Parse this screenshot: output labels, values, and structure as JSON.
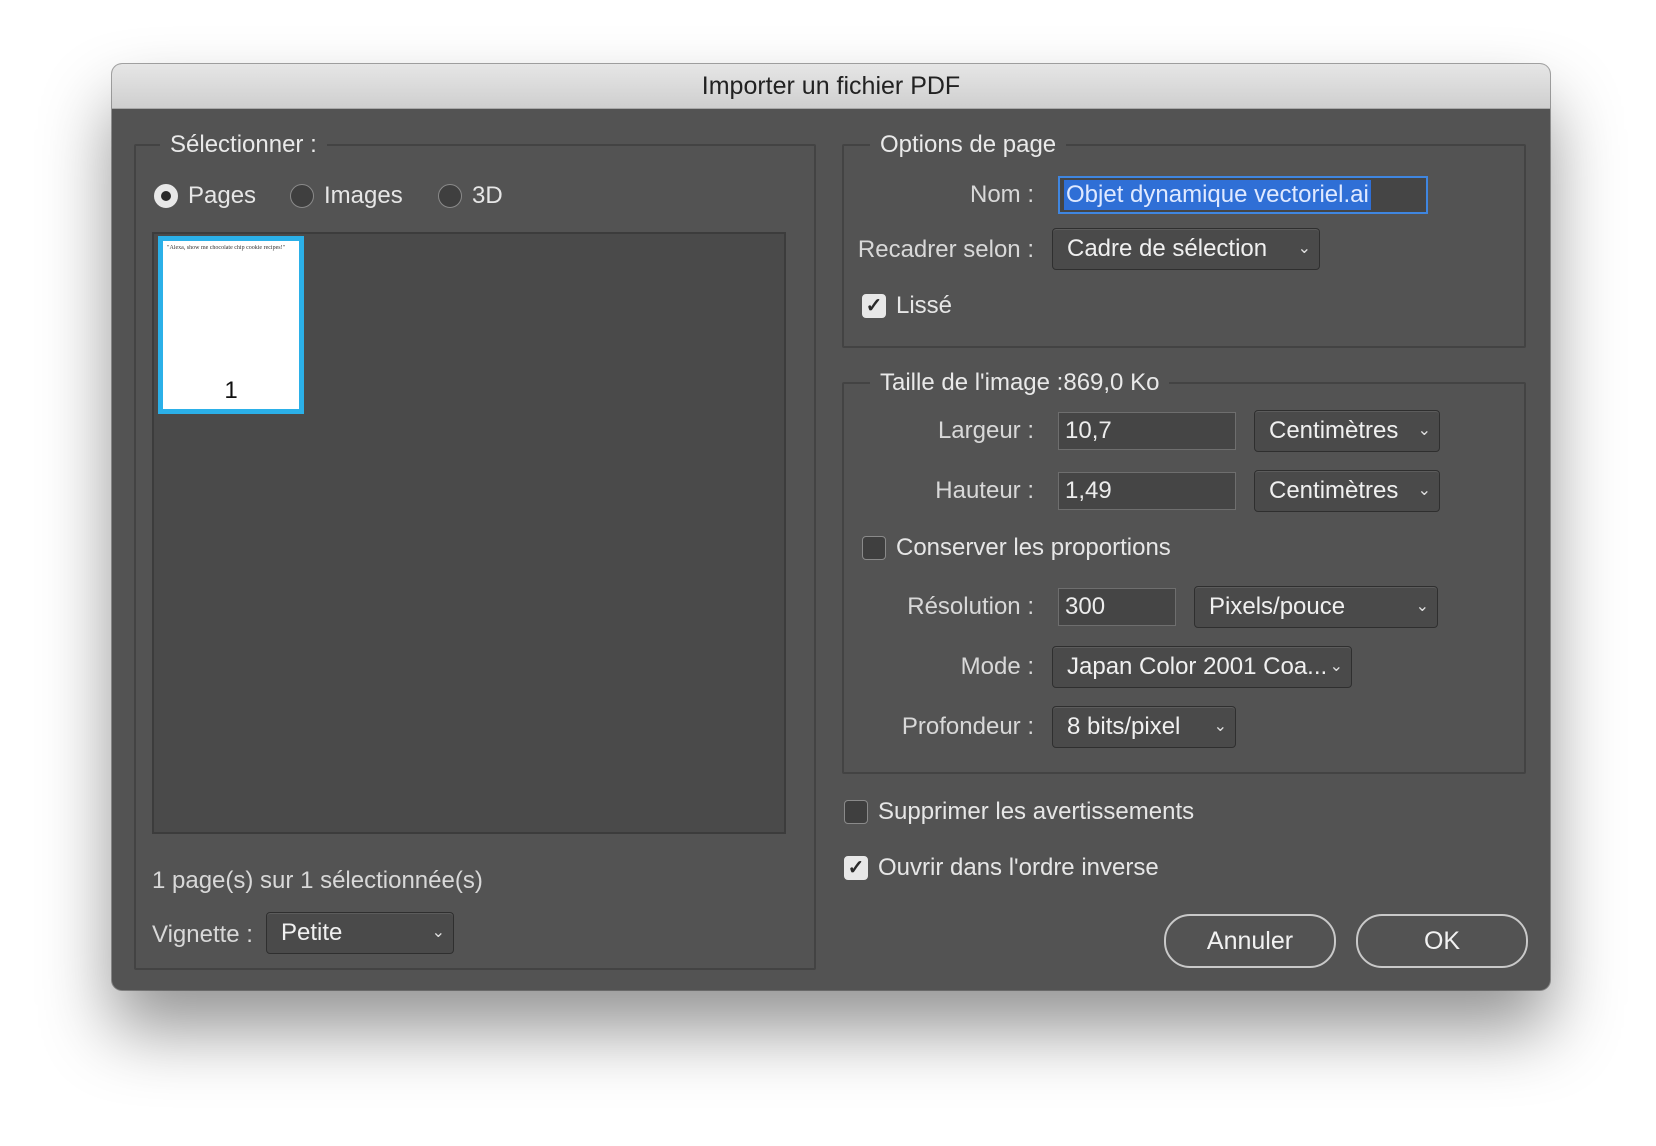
{
  "dialog": {
    "title": "Importer un fichier PDF"
  },
  "select_panel": {
    "legend": "Sélectionner :",
    "radios": [
      {
        "label": "Pages",
        "checked": true
      },
      {
        "label": "Images",
        "checked": false
      },
      {
        "label": "3D",
        "checked": false
      }
    ],
    "thumbnail": {
      "caption_text": "\"Alexa, show me chocolate chip cookie recipes!\"",
      "page_number": "1"
    },
    "status": "1 page(s) sur 1 sélectionnée(s)",
    "vignette": {
      "label": "Vignette :",
      "value": "Petite"
    }
  },
  "page_options": {
    "legend": "Options de page",
    "name": {
      "label": "Nom :",
      "value": "Objet dynamique vectoriel.ai"
    },
    "crop": {
      "label": "Recadrer selon :",
      "value": "Cadre de sélection"
    },
    "smooth": {
      "label": "Lissé",
      "checked": true
    }
  },
  "image_size": {
    "legend": "Taille de l'image :869,0 Ko",
    "width": {
      "label": "Largeur :",
      "value": "10,7",
      "unit": "Centimètres"
    },
    "height": {
      "label": "Hauteur :",
      "value": "1,49",
      "unit": "Centimètres"
    },
    "constrain": {
      "label": "Conserver les proportions",
      "checked": false
    },
    "resolution": {
      "label": "Résolution :",
      "value": "300",
      "unit": "Pixels/pouce"
    },
    "mode": {
      "label": "Mode :",
      "value": "Japan Color 2001 Coa..."
    },
    "depth": {
      "label": "Profondeur :",
      "value": "8 bits/pixel"
    }
  },
  "options": {
    "suppress": {
      "label": "Supprimer les avertissements",
      "checked": false
    },
    "reverse": {
      "label": "Ouvrir dans l'ordre inverse",
      "checked": true
    }
  },
  "buttons": {
    "cancel": "Annuler",
    "ok": "OK"
  },
  "icons": {
    "chevron": "chevron-down-icon",
    "check": "checkmark-icon"
  },
  "colors": {
    "dialog_bg": "#535353",
    "selection": "#2bb0e8",
    "highlight": "#2f6fd6"
  }
}
